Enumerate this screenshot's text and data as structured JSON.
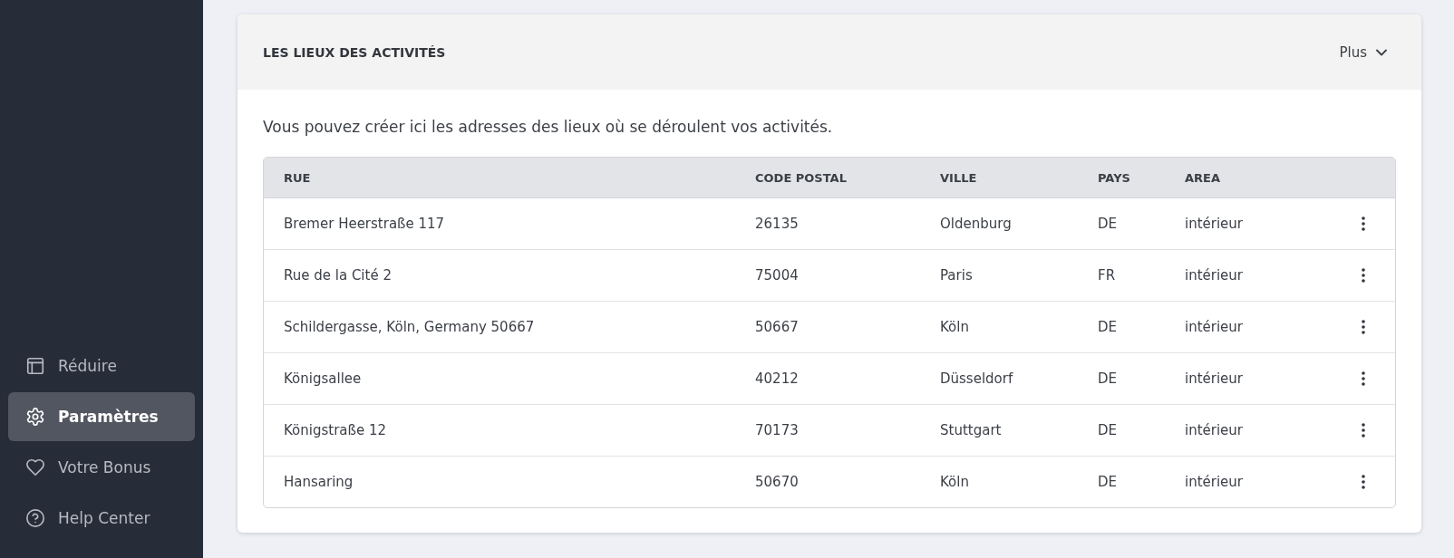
{
  "sidebar": {
    "items": [
      {
        "label": "Réduire",
        "selected": false
      },
      {
        "label": "Paramètres",
        "selected": true
      },
      {
        "label": "Votre Bonus",
        "selected": false
      },
      {
        "label": "Help Center",
        "selected": false
      }
    ]
  },
  "card": {
    "title": "LES LIEUX DES ACTIVITÉS",
    "menu_button": "Plus",
    "description": "Vous pouvez créer ici les adresses des lieux où se déroulent vos activités.",
    "table": {
      "columns": [
        "RUE",
        "CODE POSTAL",
        "VILLE",
        "PAYS",
        "AREA"
      ],
      "rows": [
        {
          "cells": [
            "Bremer Heerstraße 117",
            "26135",
            "Oldenburg",
            "DE",
            "intérieur"
          ]
        },
        {
          "cells": [
            "Rue de la Cité 2",
            "75004",
            "Paris",
            "FR",
            "intérieur"
          ]
        },
        {
          "cells": [
            "Schildergasse, Köln, Germany 50667",
            "50667",
            "Köln",
            "DE",
            "intérieur"
          ]
        },
        {
          "cells": [
            "Königsallee",
            "40212",
            "Düsseldorf",
            "DE",
            "intérieur"
          ]
        },
        {
          "cells": [
            "Königstraße 12",
            "70173",
            "Stuttgart",
            "DE",
            "intérieur"
          ]
        },
        {
          "cells": [
            "Hansaring",
            "50670",
            "Köln",
            "DE",
            "intérieur"
          ]
        }
      ]
    }
  }
}
